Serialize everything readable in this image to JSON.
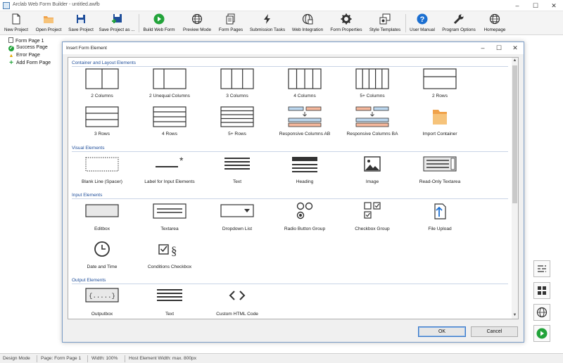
{
  "window": {
    "title": "Arclab Web Form Builder - untitled.awfb",
    "controls": [
      "–",
      "☐",
      "✕"
    ]
  },
  "toolbar": {
    "buttons": [
      {
        "label": "New Project",
        "icon": "new-document-icon"
      },
      {
        "label": "Open Project",
        "icon": "folder-open-icon"
      },
      {
        "label": "Save Project",
        "icon": "floppy-disk-icon"
      },
      {
        "label": "Save Project as ...",
        "icon": "floppy-disk-plus-icon"
      },
      {
        "label": "Build Web Form",
        "icon": "play-icon"
      },
      {
        "label": "Preview Mode",
        "icon": "globe-icon"
      },
      {
        "label": "Form Pages",
        "icon": "pages-icon"
      },
      {
        "label": "Submission Tasks",
        "icon": "lightning-icon"
      },
      {
        "label": "Web Integration",
        "icon": "globe-page-icon"
      },
      {
        "label": "Form Properties",
        "icon": "gear-icon"
      },
      {
        "label": "Style Templates",
        "icon": "style-templates-icon"
      },
      {
        "label": "User Manual",
        "icon": "help-icon"
      },
      {
        "label": "Program Options",
        "icon": "wrench-icon"
      },
      {
        "label": "Homepage",
        "icon": "globe-icon"
      }
    ]
  },
  "tree": {
    "items": [
      {
        "label": "Form Page 1",
        "icon": "page-icon"
      },
      {
        "label": "Success Page",
        "icon": "check-icon"
      },
      {
        "label": "Error Page",
        "icon": "warning-icon"
      },
      {
        "label": "Add Form Page",
        "icon": "plus-icon"
      }
    ]
  },
  "dialog": {
    "title": "Insert Form Element",
    "controls": [
      "–",
      "☐",
      "✕"
    ],
    "ok_label": "OK",
    "cancel_label": "Cancel",
    "sections": [
      {
        "title": "Container and Layout Elements",
        "items": [
          {
            "label": "2 Columns",
            "icon": "two-columns-icon"
          },
          {
            "label": "2 Unequal Columns",
            "icon": "two-unequal-columns-icon"
          },
          {
            "label": "3 Columns",
            "icon": "three-columns-icon"
          },
          {
            "label": "4 Columns",
            "icon": "four-columns-icon"
          },
          {
            "label": "5+ Columns",
            "icon": "five-columns-icon"
          },
          {
            "label": "2 Rows",
            "icon": "two-rows-icon"
          },
          {
            "label": "3 Rows",
            "icon": "three-rows-icon"
          },
          {
            "label": "4 Rows",
            "icon": "four-rows-icon"
          },
          {
            "label": "5+ Rows",
            "icon": "five-rows-icon"
          },
          {
            "label": "Responsive Columns AB",
            "icon": "responsive-columns-ab-icon"
          },
          {
            "label": "Responsive Columns BA",
            "icon": "responsive-columns-ba-icon"
          },
          {
            "label": "Import Container",
            "icon": "import-folder-icon"
          }
        ]
      },
      {
        "title": "Visual Elements",
        "items": [
          {
            "label": "Blank Line (Spacer)",
            "icon": "blank-line-icon"
          },
          {
            "label": "Label for Input Elements",
            "icon": "label-asterisk-icon"
          },
          {
            "label": "Text",
            "icon": "text-lines-icon"
          },
          {
            "label": "Heading",
            "icon": "heading-icon"
          },
          {
            "label": "Image",
            "icon": "image-icon"
          },
          {
            "label": "Read-Only Textarea",
            "icon": "readonly-textarea-icon"
          }
        ]
      },
      {
        "title": "Input Elements",
        "items": [
          {
            "label": "Editbox",
            "icon": "editbox-icon"
          },
          {
            "label": "Textarea",
            "icon": "textarea-icon"
          },
          {
            "label": "Dropdown List",
            "icon": "dropdown-icon"
          },
          {
            "label": "Radio Button Group",
            "icon": "radio-group-icon"
          },
          {
            "label": "Checkbox Group",
            "icon": "checkbox-group-icon"
          },
          {
            "label": "File Upload",
            "icon": "file-upload-icon"
          },
          {
            "label": "Date and Time",
            "icon": "clock-icon"
          },
          {
            "label": "Conditions Checkbox",
            "icon": "conditions-checkbox-icon"
          }
        ]
      },
      {
        "title": "Output Elements",
        "items": [
          {
            "label": "Outputbox",
            "icon": "outputbox-icon"
          },
          {
            "label": "Text",
            "icon": "text-lines-icon"
          },
          {
            "label": "Custom HTML Code",
            "icon": "code-brackets-icon"
          }
        ]
      }
    ]
  },
  "side_buttons": [
    {
      "icon": "properties-list-icon"
    },
    {
      "icon": "grid-icon"
    },
    {
      "icon": "globe-icon"
    },
    {
      "icon": "play-icon"
    }
  ],
  "status": {
    "mode": "Design Mode",
    "page": "Page: Form Page 1",
    "width": "Width: 100%",
    "host": "Host Element Width: max. 800px"
  },
  "colors": {
    "accent_blue": "#1f4e9a",
    "play_green": "#22a33a",
    "help_blue": "#1b6fd1",
    "responsive_blue": "#bcd7ee",
    "responsive_orange": "#f4b79c",
    "folder_orange": "#f0a24a"
  }
}
